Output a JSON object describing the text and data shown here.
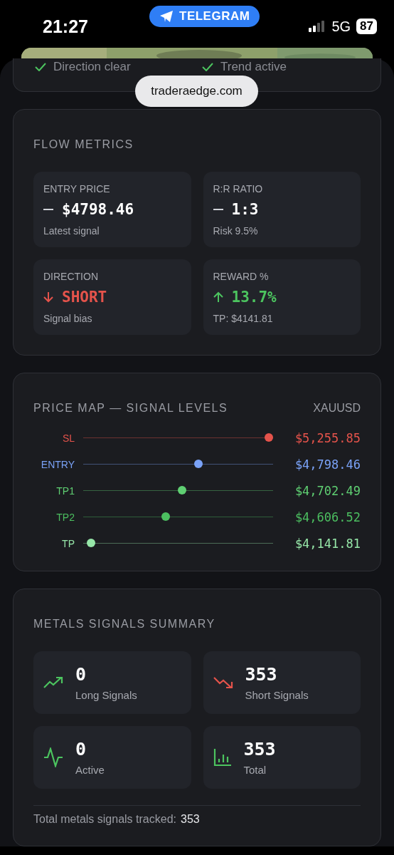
{
  "status_bar": {
    "time": "21:27",
    "app_pill": "TELEGRAM",
    "network": "5G",
    "battery": "87"
  },
  "browser": {
    "url": "traderaedge.com"
  },
  "checks": [
    {
      "label": "Direction clear",
      "checked": true
    },
    {
      "label": "Trend active",
      "checked": true
    }
  ],
  "flow_metrics": {
    "title": "FLOW METRICS",
    "cards": [
      {
        "label": "ENTRY PRICE",
        "kind": "flat",
        "value": "$4798.46",
        "note": "Latest signal"
      },
      {
        "label": "R:R RATIO",
        "kind": "flat",
        "value": "1:3",
        "note": "Risk 9.5%"
      },
      {
        "label": "DIRECTION",
        "kind": "down",
        "value": "SHORT",
        "note": "Signal bias"
      },
      {
        "label": "REWARD %",
        "kind": "up",
        "value": "13.7%",
        "note": "TP: $4141.81"
      }
    ]
  },
  "price_map": {
    "title": "PRICE MAP — SIGNAL LEVELS",
    "symbol": "XAUUSD",
    "levels": [
      {
        "label": "SL",
        "color": "#e5534b",
        "level": 1.0,
        "price": "$5,255.85"
      },
      {
        "label": "ENTRY",
        "color": "#7aa2f7",
        "level": 0.61,
        "price": "$4,798.46"
      },
      {
        "label": "TP1",
        "color": "#5fcf72",
        "level": 0.52,
        "price": "$4,702.49"
      },
      {
        "label": "TP2",
        "color": "#4cbf60",
        "level": 0.43,
        "price": "$4,606.52"
      },
      {
        "label": "TP",
        "color": "#96e6a8",
        "level": 0.02,
        "price": "$4,141.81"
      }
    ]
  },
  "summary": {
    "title": "METALS SIGNALS SUMMARY",
    "stats": [
      {
        "kind": "trend-up",
        "value": "0",
        "label": "Long Signals"
      },
      {
        "kind": "trend-down",
        "value": "353",
        "label": "Short Signals"
      },
      {
        "kind": "pulse",
        "value": "0",
        "label": "Active"
      },
      {
        "kind": "bars",
        "value": "353",
        "label": "Total"
      }
    ],
    "footer_label": "Total metals signals tracked:",
    "footer_value": "353"
  }
}
